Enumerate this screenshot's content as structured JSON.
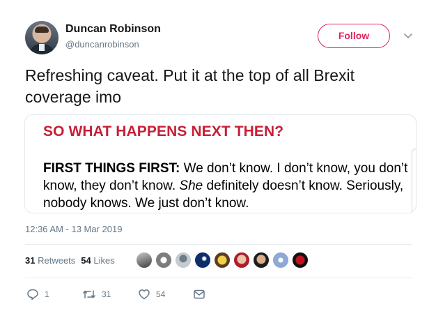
{
  "user": {
    "display_name": "Duncan Robinson",
    "handle": "@duncanrobinson"
  },
  "follow_label": "Follow",
  "tweet": {
    "text": "Refreshing caveat. Put it at the top of all Brexit coverage imo"
  },
  "card": {
    "heading": "SO WHAT HAPPENS NEXT THEN?",
    "lead": "FIRST THINGS FIRST:",
    "text_1": " We don’t know. I don’t know, you don’t know, they don’t know. ",
    "emphasis": "She",
    "text_2": " definitely doesn’t know. Seriously, nobody knows. We just don’t know."
  },
  "timestamp": "12:36 AM - 13 Mar 2019",
  "stats": {
    "retweets_count": "31",
    "retweets_label": "Retweets",
    "likes_count": "54",
    "likes_label": "Likes"
  },
  "actions": {
    "replies": "1",
    "retweets": "31",
    "likes": "54"
  },
  "colors": {
    "accent": "#e0245e",
    "card_heading": "#c71f37",
    "muted": "#657786"
  }
}
